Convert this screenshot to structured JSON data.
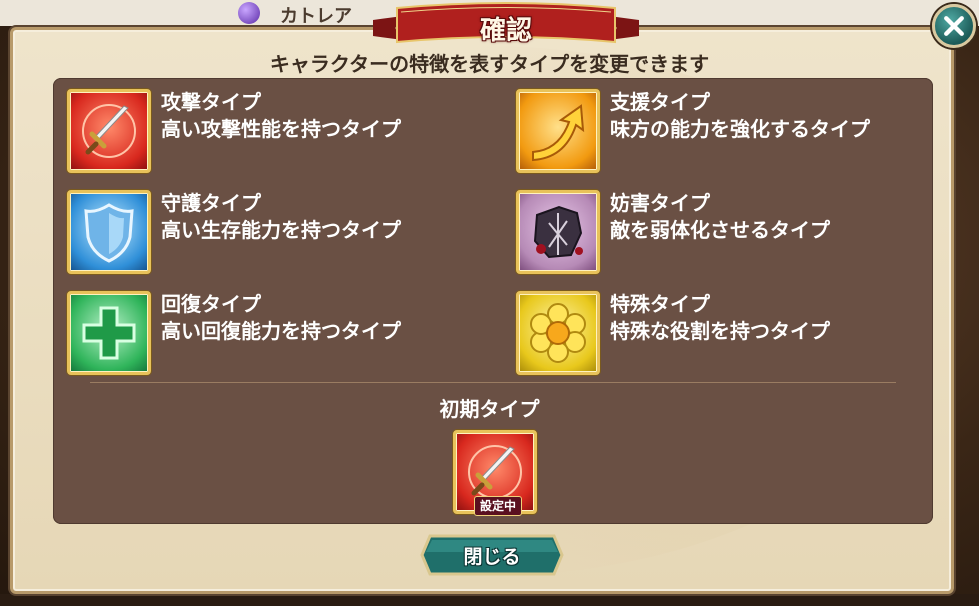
{
  "background": {
    "partial_name": "カトレア"
  },
  "dialog": {
    "title": "確認",
    "subtitle": "キャラクターの特徴を表すタイプを変更できます",
    "close_icon": "close-icon"
  },
  "types": [
    {
      "name": "攻撃タイプ",
      "desc": "高い攻撃性能を持つタイプ",
      "icon": "sword-icon",
      "color": "#e8453c"
    },
    {
      "name": "支援タイプ",
      "desc": "味方の能力を強化するタイプ",
      "icon": "arrow-up-icon",
      "color": "#f2a11c"
    },
    {
      "name": "守護タイプ",
      "desc": "高い生存能力を持つタイプ",
      "icon": "shield-icon",
      "color": "#2f8fd8"
    },
    {
      "name": "妨害タイプ",
      "desc": "敵を弱体化させるタイプ",
      "icon": "broken-shield-icon",
      "color": "#8a3a8a"
    },
    {
      "name": "回復タイプ",
      "desc": "高い回復能力を持つタイプ",
      "icon": "cross-icon",
      "color": "#2fb45a"
    },
    {
      "name": "特殊タイプ",
      "desc": "特殊な役割を持つタイプ",
      "icon": "flower-icon",
      "color": "#e8c81c"
    }
  ],
  "initial": {
    "label": "初期タイプ",
    "badge": "設定中",
    "icon": "sword-icon"
  },
  "buttons": {
    "close_label": "閉じる"
  }
}
